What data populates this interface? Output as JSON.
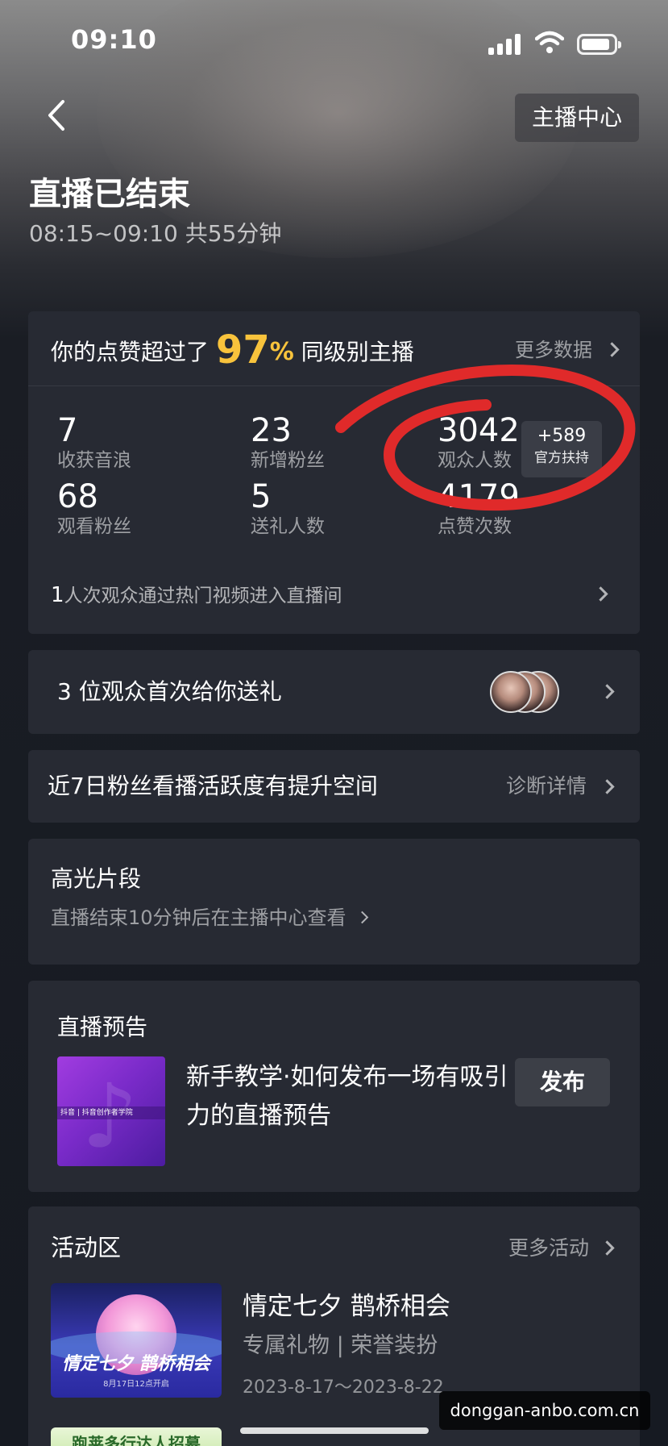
{
  "status_bar": {
    "time": "09:10"
  },
  "header": {
    "anchor_center_label": "主播中心",
    "title": "直播已结束",
    "subtitle": "08:15~09:10 共55分钟"
  },
  "stats": {
    "likes_prefix": "你的点赞超过了",
    "likes_percent": "97",
    "likes_percent_sign": "%",
    "likes_suffix": "同级别主播",
    "more_data": "更多数据",
    "items": [
      {
        "value": "7",
        "label": "收获音浪"
      },
      {
        "value": "23",
        "label": "新增粉丝"
      },
      {
        "value": "3042",
        "label": "观众人数"
      },
      {
        "value": "68",
        "label": "观看粉丝"
      },
      {
        "value": "5",
        "label": "送礼人数"
      },
      {
        "value": "4179",
        "label": "点赞次数"
      }
    ],
    "badge_value": "+589",
    "badge_label": "官方扶持",
    "hot_count": "1",
    "hot_text": "人次观众通过热门视频进入直播间"
  },
  "gift": {
    "text": "3 位观众首次给你送礼"
  },
  "fans": {
    "text": "近7日粉丝看播活跃度有提升空间",
    "diagnose": "诊断详情"
  },
  "highlight": {
    "title": "高光片段",
    "subtitle": "直播结束10分钟后在主播中心查看"
  },
  "preview": {
    "title": "直播预告",
    "thumb_text": "抖音 | 抖音创作者学院",
    "desc": "新手教学·如何发布一场有吸引力的直播预告",
    "publish": "发布"
  },
  "activity": {
    "title": "活动区",
    "more": "更多活动",
    "poster_title": "情定七夕 鹊桥相会",
    "poster_date": "8月17日12点开启",
    "name": "情定七夕 鹊桥相会",
    "tags": "专属礼物 | 荣誉装扮",
    "dates": "2023-8-17～2023-8-22",
    "recruit": "跑莱多行达人招募"
  },
  "watermark": "donggan-anbo.com.cn",
  "colors": {
    "accent": "#f8c33c",
    "annotation": "#e02a2a",
    "card": "#272a33"
  }
}
